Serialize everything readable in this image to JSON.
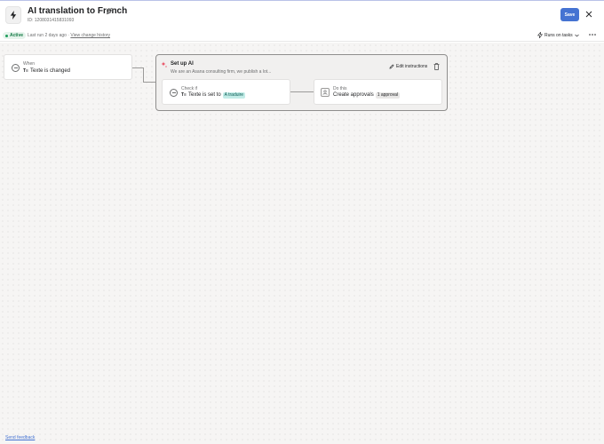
{
  "header": {
    "title": "AI translation to French",
    "rule_id": "ID: 1208031415831093",
    "save_label": "Save"
  },
  "status": {
    "badge": "Active",
    "last_run": "Last run 2 days ago · ",
    "history_link": "View change history",
    "runs_on": "Runs on tasks"
  },
  "trigger": {
    "label": "When",
    "field_icon": "T≡",
    "field": "Texte",
    "text": " is changed"
  },
  "ai": {
    "title": "Set up AI",
    "description": "We are an Asana consulting firm, we publish a lot...",
    "edit_label": "Edit instructions"
  },
  "check": {
    "label": "Check if",
    "field_icon": "T≡",
    "field": "Texte",
    "text": " is set to",
    "value": "A traduire"
  },
  "action": {
    "label": "Do this",
    "text": "Create approvals",
    "count": "1 approval"
  },
  "footer": {
    "feedback": "Send feedback"
  },
  "colors": {
    "accent": "#4573d2",
    "active": "#1e9d5b",
    "sparkle": "#e8384f",
    "teal_pill": "#c2ece7"
  },
  "icons": {
    "app": "lightning-icon",
    "edit_title": "pencil-icon",
    "close": "close-icon",
    "runs_on": "lightning-outline-icon",
    "ai": "sparkle-icon",
    "delete": "trash-icon",
    "approval": "person-badge-icon"
  }
}
